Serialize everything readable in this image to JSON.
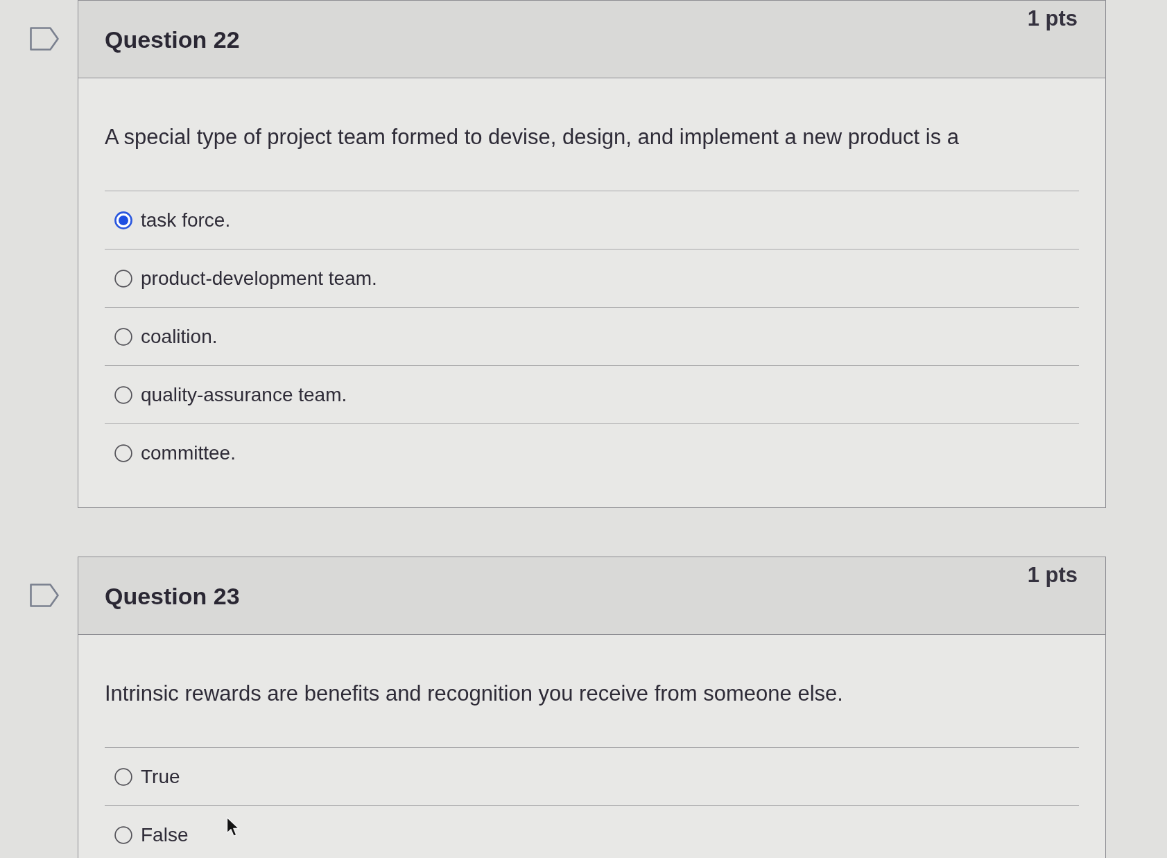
{
  "questions": [
    {
      "title": "Question 22",
      "points": "1 pts",
      "flagged": false,
      "prompt": "A special type of project team formed to devise, design, and implement a new product is a",
      "options": [
        {
          "label": "task force.",
          "selected": true
        },
        {
          "label": "product-development team.",
          "selected": false
        },
        {
          "label": "coalition.",
          "selected": false
        },
        {
          "label": "quality-assurance team.",
          "selected": false
        },
        {
          "label": "committee.",
          "selected": false
        }
      ]
    },
    {
      "title": "Question 23",
      "points": "1 pts",
      "flagged": false,
      "prompt": "Intrinsic rewards are benefits and recognition you receive from someone else.",
      "options": [
        {
          "label": "True",
          "selected": false
        },
        {
          "label": "False",
          "selected": false
        }
      ]
    }
  ]
}
